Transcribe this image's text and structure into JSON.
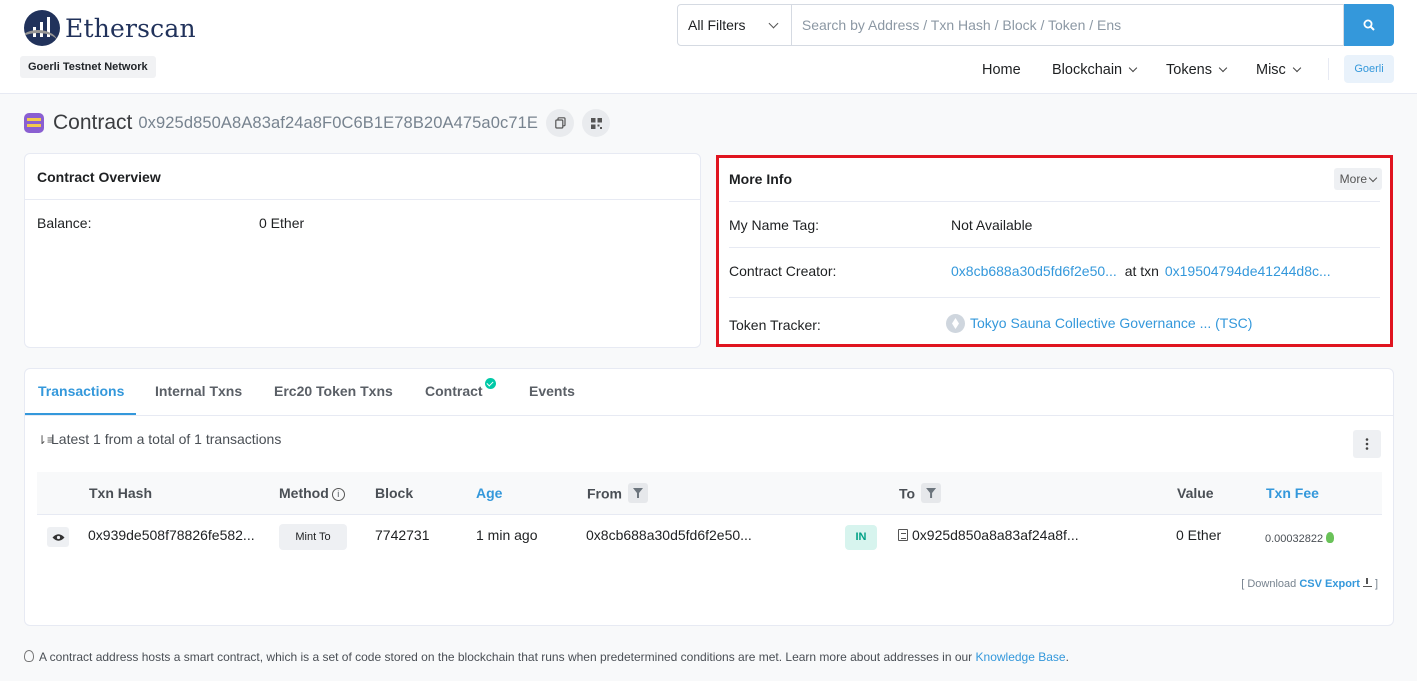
{
  "header": {
    "logo_text": "Etherscan",
    "network_badge": "Goerli Testnet Network",
    "filter_label": "All Filters",
    "search_placeholder": "Search by Address / Txn Hash / Block / Token / Ens",
    "nav": [
      "Home",
      "Blockchain",
      "Tokens",
      "Misc"
    ],
    "network_button": "Goerli"
  },
  "contract": {
    "title": "Contract",
    "address": "0x925d850A8A83af24a8F0C6B1E78B20A475a0c71E"
  },
  "overview": {
    "title": "Contract Overview",
    "balance_label": "Balance:",
    "balance_value": "0 Ether"
  },
  "more_info": {
    "title": "More Info",
    "more_button": "More",
    "name_tag_label": "My Name Tag:",
    "name_tag_value": "Not Available",
    "creator_label": "Contract Creator:",
    "creator_address": "0x8cb688a30d5fd6f2e50...",
    "creator_at_txn": "at txn",
    "creator_txn": "0x19504794de41244d8c...",
    "token_label": "Token Tracker:",
    "token_value": "Tokyo Sauna Collective Governance ... (TSC)"
  },
  "tabs": [
    "Transactions",
    "Internal Txns",
    "Erc20 Token Txns",
    "Contract",
    "Events"
  ],
  "transactions": {
    "summary": "Latest 1 from a total of 1 transactions",
    "columns": [
      "Txn Hash",
      "Method",
      "Block",
      "Age",
      "From",
      "To",
      "Value",
      "Txn Fee"
    ],
    "rows": [
      {
        "hash": "0x939de508f78826fe582...",
        "method": "Mint To",
        "block": "7742731",
        "age": "1 min ago",
        "from": "0x8cb688a30d5fd6f2e50...",
        "direction": "IN",
        "to": "0x925d850a8a83af24a8f...",
        "value": "0 Ether",
        "fee": "0.00032822"
      }
    ],
    "csv_prefix": "[ Download",
    "csv_link": "CSV Export",
    "csv_suffix": "]"
  },
  "footer_note": {
    "text": "A contract address hosts a smart contract, which is a set of code stored on the blockchain that runs when predetermined conditions are met. Learn more about addresses in our",
    "link": "Knowledge Base",
    "end": "."
  },
  "colors": {
    "accent": "#3498db",
    "highlight_border": "#e0141f",
    "in_badge": "#00a186"
  },
  "icons": [
    "etherscan-logo-icon",
    "search-icon",
    "copy-icon",
    "qr-code-icon",
    "contract-icon",
    "ether-token-icon",
    "verified-check-icon",
    "sort-icon",
    "kebab-menu-icon",
    "eye-icon",
    "filter-icon",
    "info-icon",
    "document-icon",
    "bulb-icon",
    "download-icon"
  ]
}
